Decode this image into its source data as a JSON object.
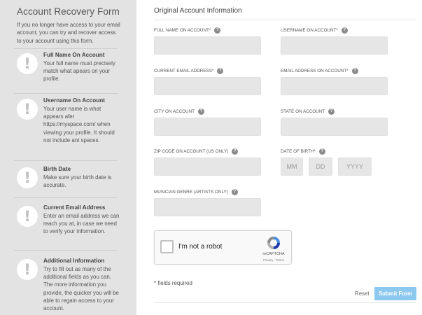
{
  "sidebar": {
    "title": "Account Recovery Form",
    "intro": "If you no longer have access to your email account, you can try and recover access to your account using this form.",
    "tips": [
      {
        "icon": "exclamation-icon",
        "title": "Full Name On Account",
        "body": "Your full name must precisely match what apears on your profile."
      },
      {
        "icon": "exclamation-icon",
        "title": "Username On Account",
        "body": "Your user name is what appears afer https://myspace.com/ when viewing your profile. It should not include ant spaces."
      },
      {
        "icon": "exclamation-icon",
        "title": "Birth Date",
        "body": "Make sure your birth date is accurate."
      },
      {
        "icon": "exclamation-icon",
        "title": "Current Email Address",
        "body": "Enter an email address we can reach you at, in case we need to verify your information."
      },
      {
        "icon": "exclamation-icon",
        "title": "Additional Information",
        "body": "Try to fill out as many of the additional fields as you can. The more information you provide, the quicker you will be able to regain access to your account."
      }
    ]
  },
  "form": {
    "title": "Original Account Information",
    "fields": {
      "full_name": {
        "label": "Full Name On Account*",
        "value": ""
      },
      "username": {
        "label": "Username On Account*",
        "value": ""
      },
      "current_email": {
        "label": "Current Email Address*",
        "value": ""
      },
      "email_on_account": {
        "label": "Email Address On Account*",
        "value": ""
      },
      "city": {
        "label": "City On Account",
        "value": ""
      },
      "state": {
        "label": "State On Account",
        "value": ""
      },
      "zip": {
        "label": "Zip Code On Account (US Only)",
        "value": ""
      },
      "dob": {
        "label": "Date Of Birth*",
        "month_placeholder": "MM",
        "day_placeholder": "DD",
        "year_placeholder": "YYYY"
      },
      "genre": {
        "label": "Musician Genre (Artists Only)",
        "value": ""
      }
    },
    "help_icon": "?",
    "captcha": {
      "label": "I'm not a robot",
      "brand": "reCAPTCHA",
      "links": "Privacy - Terms",
      "checked": false
    },
    "required_note": "* fields required",
    "reset_label": "Reset",
    "submit_label": "Submit Form"
  },
  "colors": {
    "sidebar_bg": "#e3e3e3",
    "input_bg": "#e6e6e6",
    "submit_bg": "#8dc8ef"
  }
}
